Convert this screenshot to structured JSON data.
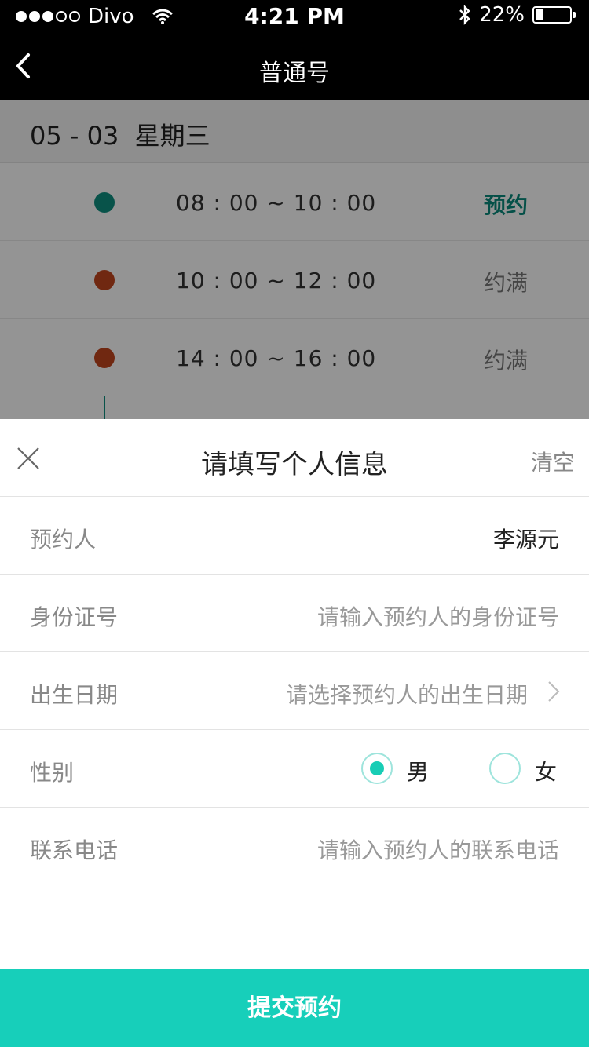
{
  "status_bar": {
    "carrier": "Divo",
    "time": "4:21 PM",
    "battery": "22%",
    "signal_bars": 3,
    "icons": [
      "signal-dots-icon",
      "wifi-icon",
      "bluetooth-icon",
      "battery-icon"
    ]
  },
  "nav": {
    "title": "普通号",
    "back_icon": "back-chevron-icon"
  },
  "schedule": {
    "date": "05 - 03",
    "weekday": "星期三",
    "slots": [
      {
        "time": "08 : 00 ~ 10 : 00",
        "status": "预约",
        "status_color": "#0a8a7c",
        "marker_color": "#0f8f80"
      },
      {
        "time": "10 : 00 ~ 12 : 00",
        "status": "约满",
        "status_color": "#777777",
        "marker_color": "#c2451e"
      },
      {
        "time": "14 : 00 ~ 16 : 00",
        "status": "约满",
        "status_color": "#777777",
        "marker_color": "#c2451e"
      }
    ]
  },
  "sheet": {
    "title": "请填写个人信息",
    "clear_label": "清空",
    "close_icon": "close-icon",
    "fields": {
      "name": {
        "label": "预约人",
        "value": "李源元"
      },
      "id_number": {
        "label": "身份证号",
        "placeholder": "请输入预约人的身份证号"
      },
      "birth_date": {
        "label": "出生日期",
        "placeholder": "请选择预约人的出生日期"
      },
      "gender": {
        "label": "性别",
        "options": [
          "男",
          "女"
        ],
        "selected": "男"
      },
      "phone": {
        "label": "联系电话",
        "placeholder": "请输入预约人的联系电话"
      }
    }
  },
  "submit_label": "提交预约",
  "colors": {
    "accent": "#17cfba",
    "header_bg": "#000000",
    "overlay": "rgba(0,0,0,0.42)"
  }
}
